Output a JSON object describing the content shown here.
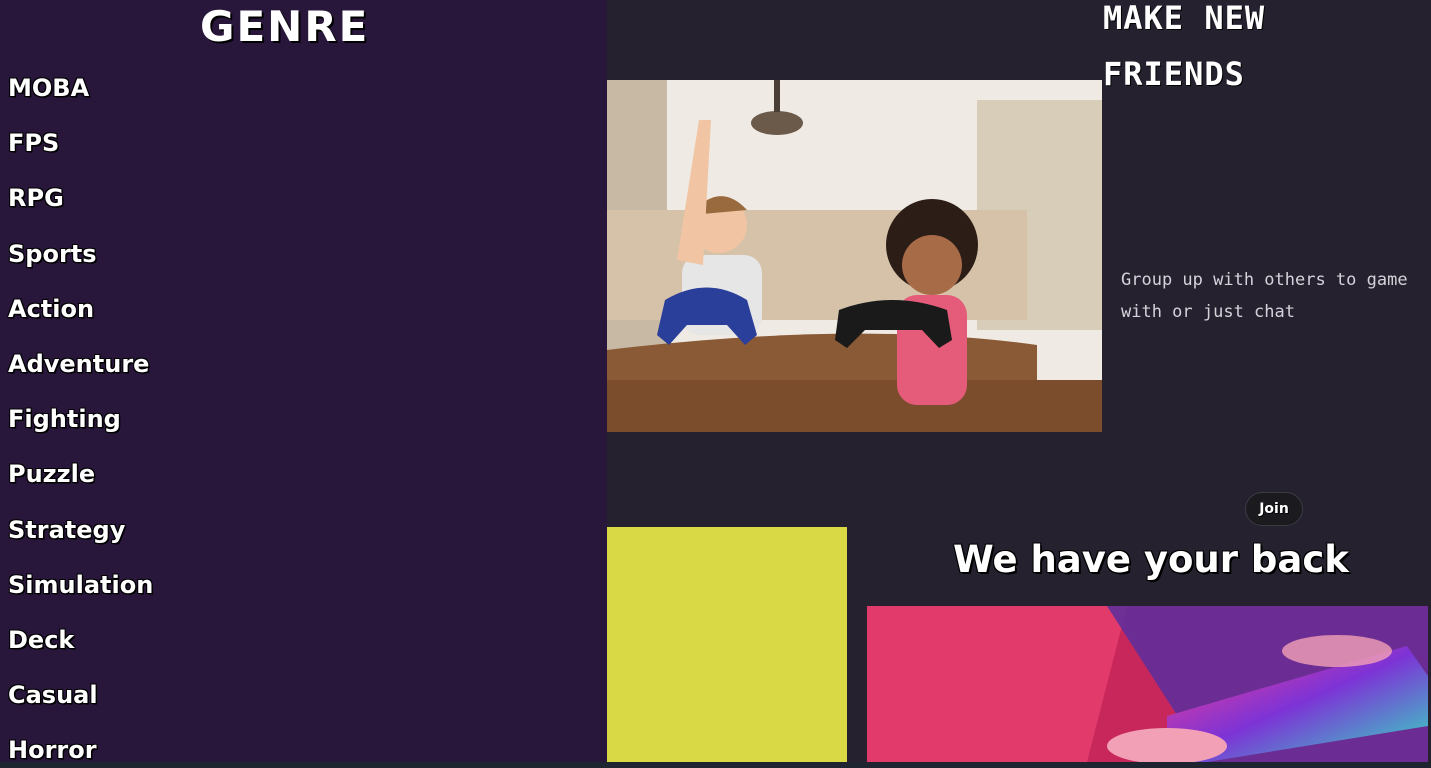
{
  "sidebar": {
    "title": "GENRE",
    "items": [
      {
        "label": "MOBA"
      },
      {
        "label": "FPS"
      },
      {
        "label": "RPG"
      },
      {
        "label": "Sports"
      },
      {
        "label": "Action"
      },
      {
        "label": "Adventure"
      },
      {
        "label": "Fighting"
      },
      {
        "label": "Puzzle"
      },
      {
        "label": "Strategy"
      },
      {
        "label": "Simulation"
      },
      {
        "label": "Deck"
      },
      {
        "label": "Casual"
      },
      {
        "label": "Horror"
      }
    ]
  },
  "friends": {
    "title": "MAKE NEW FRIENDS",
    "text": "Group up with others to game with or just chat",
    "join_label": "Join",
    "image_icon": "kids-gaming-photo"
  },
  "support": {
    "title": "We have your back",
    "image_icon": "gamer-keyboard-photo"
  },
  "colors": {
    "sidebar_bg": "#28173a",
    "content_bg": "#25212f",
    "accent_yellow": "#d9d945",
    "text": "#ffffff"
  }
}
